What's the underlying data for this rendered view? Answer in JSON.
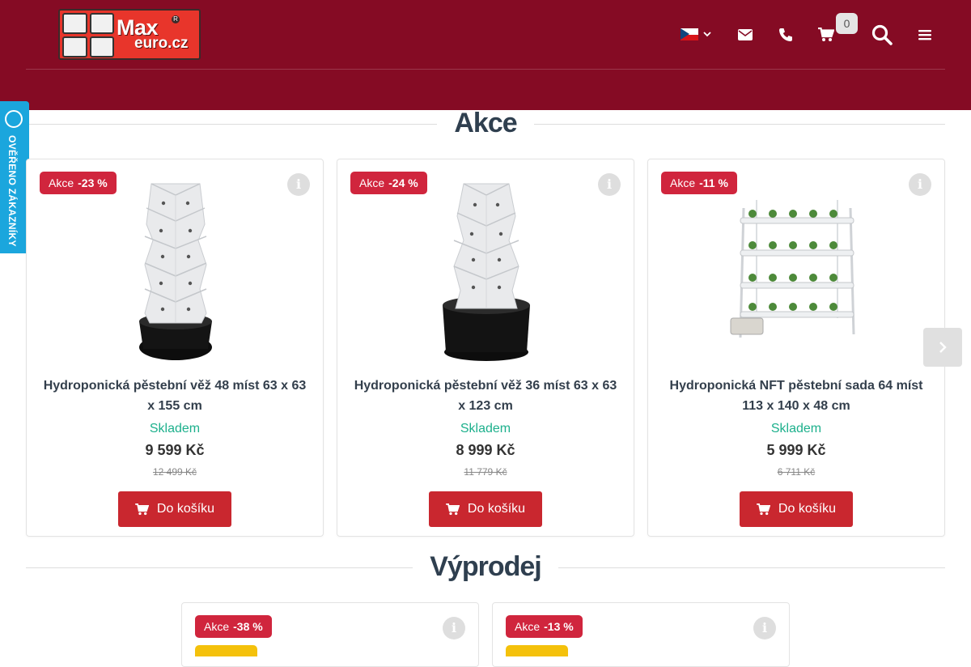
{
  "header": {
    "logo": {
      "brand_top": "Max",
      "brand_bottom": "euro.cz",
      "reg": "R"
    },
    "cart_count": "0",
    "icons": {
      "language": "czech-flag-icon",
      "email": "envelope-icon",
      "phone": "phone-icon",
      "cart": "cart-icon",
      "search": "search-icon",
      "menu": "hamburger-menu-icon"
    },
    "colors": {
      "background": "#850b24"
    }
  },
  "review_badge": {
    "label": "OVĚŘENO ZÁKAZNÍKY",
    "color": "#1ba6dd"
  },
  "sections": [
    {
      "title": "Akce",
      "products": [
        {
          "badge_label": "Akce",
          "discount": "-23 %",
          "name": "Hydroponická pěstební věž 48 míst 63 x 63 x 155 cm",
          "stock": "Skladem",
          "price": "9 599 Kč",
          "old_price": "12 499 Kč",
          "button": "Do košíku"
        },
        {
          "badge_label": "Akce",
          "discount": "-24 %",
          "name": "Hydroponická pěstební věž 36 míst 63 x 63 x 123 cm",
          "stock": "Skladem",
          "price": "8 999 Kč",
          "old_price": "11 779 Kč",
          "button": "Do košíku"
        },
        {
          "badge_label": "Akce",
          "discount": "-11 %",
          "name": "Hydroponická NFT pěstební sada 64 míst 113 x 140 x 48 cm",
          "stock": "Skladem",
          "price": "5 999 Kč",
          "old_price": "6 711 Kč",
          "button": "Do košíku"
        }
      ]
    },
    {
      "title": "Výprodej",
      "products": [
        {
          "badge_label": "Akce",
          "discount": "-38 %"
        },
        {
          "badge_label": "Akce",
          "discount": "-13 %"
        }
      ]
    }
  ],
  "colors": {
    "accent": "#c9272f",
    "badge": "#d0253d",
    "stock": "#1db08c"
  }
}
